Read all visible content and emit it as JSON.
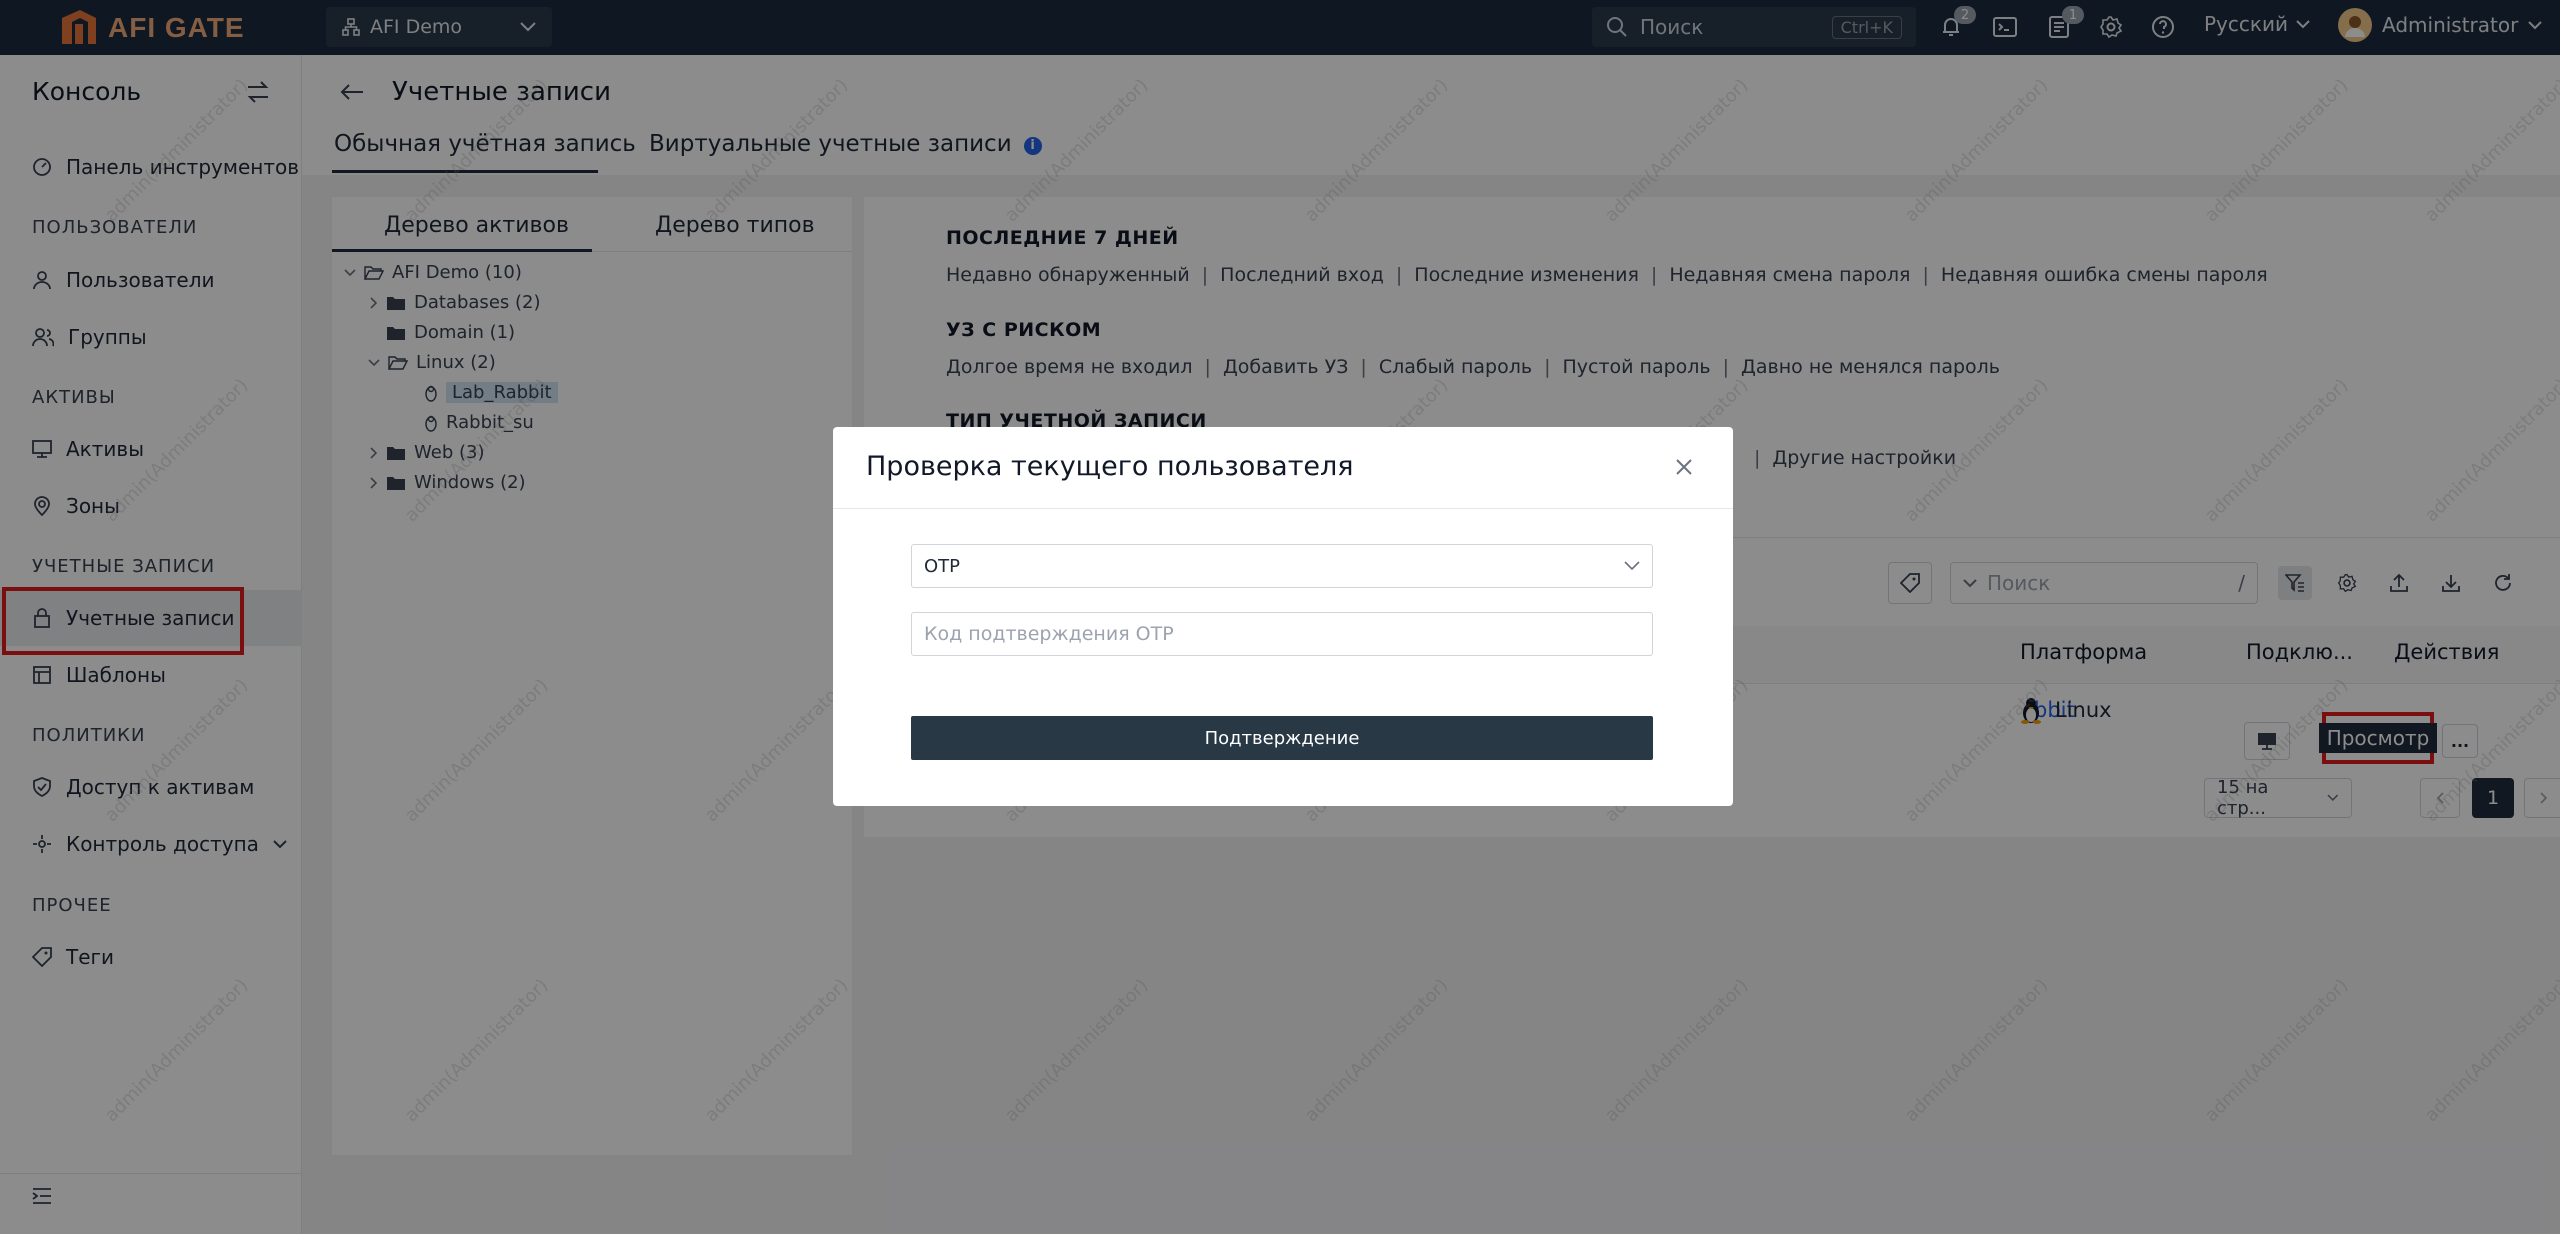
{
  "topbar": {
    "logo_text": "AFI GATE",
    "org_name": "AFI Demo",
    "search_placeholder": "Поиск",
    "search_shortcut": "Ctrl+K",
    "notifications_badge": "2",
    "tasks_badge": "1",
    "language": "Русский",
    "user_name": "Administrator"
  },
  "sidebar": {
    "title": "Консоль",
    "dashboard": "Панель инструментов",
    "group_users": "ПОЛЬЗОВАТЕЛИ",
    "users": "Пользователи",
    "groups": "Группы",
    "group_assets": "АКТИВЫ",
    "assets": "Активы",
    "zones": "Зоны",
    "group_accounts": "УЧЕТНЫЕ ЗАПИСИ",
    "accounts": "Учетные записи",
    "templates": "Шаблоны",
    "group_policies": "ПОЛИТИКИ",
    "asset_access": "Доступ к активам",
    "access_control": "Контроль доступа",
    "group_other": "ПРОЧЕЕ",
    "tags": "Теги"
  },
  "page": {
    "title": "Учетные записи",
    "tab_regular": "Обычная учётная запись",
    "tab_virtual": "Виртуальные учетные записи"
  },
  "tree": {
    "tab_assets": "Дерево активов",
    "tab_types": "Дерево типов",
    "root": "AFI Demo (10)",
    "databases": "Databases (2)",
    "domain": "Domain (1)",
    "linux": "Linux (2)",
    "lab_rabbit": "Lab_Rabbit",
    "rabbit_su": "Rabbit_su",
    "web": "Web (3)",
    "windows": "Windows (2)"
  },
  "filters": {
    "recent_title": "ПОСЛЕДНИЕ 7 ДНЕЙ",
    "recent": [
      "Недавно обнаруженный",
      "Последний вход",
      "Последние изменения",
      "Недавняя смена пароля",
      "Недавняя ошибка смены пароля"
    ],
    "risk_title": "УЗ С РИСКОМ",
    "risk": [
      "Долгое время не входил",
      "Добавить УЗ",
      "Слабый пароль",
      "Пустой пароль",
      "Давно не менялся пароль"
    ],
    "type_title": "ТИП УЧЕТНОЙ ЗАПИСИ",
    "type_other": "Другие настройки"
  },
  "table": {
    "search_placeholder": "Поиск",
    "search_slash": "/",
    "col_platform": "Платформа",
    "col_connect": "Подклю...",
    "col_actions": "Действия",
    "row_name_partial": "bbit",
    "row_platform": "Linux",
    "view_label": "Просмотр",
    "more_label": "...",
    "page_size": "15 на стр...",
    "current_page": "1"
  },
  "modal": {
    "title": "Проверка текущего пользователя",
    "method": "OTP",
    "code_placeholder": "Код подтверждения OTP",
    "confirm_label": "Подтверждение"
  },
  "watermark_text": "admin(Administrator)"
}
